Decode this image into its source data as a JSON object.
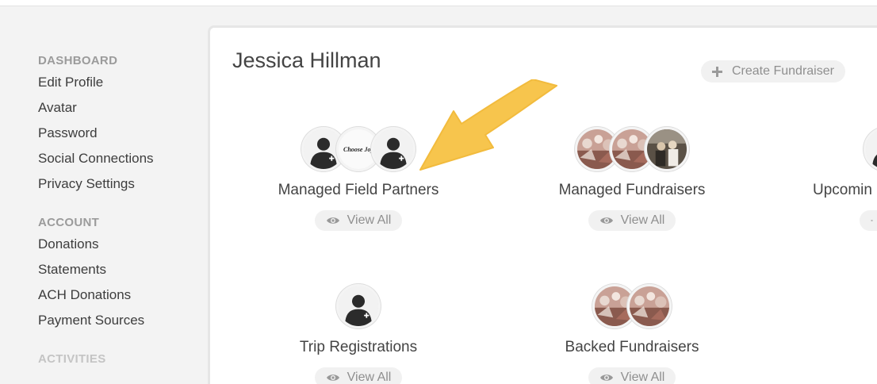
{
  "sidebar": {
    "groups": [
      {
        "heading": "DASHBOARD",
        "items": [
          "Edit Profile",
          "Avatar",
          "Password",
          "Social Connections",
          "Privacy Settings"
        ]
      },
      {
        "heading": "ACCOUNT",
        "items": [
          "Donations",
          "Statements",
          "ACH Donations",
          "Payment Sources"
        ]
      },
      {
        "heading": "ACTIVITIES",
        "items": []
      }
    ]
  },
  "panel": {
    "title": "Jessica Hillman",
    "create_label": "Create Fundraiser"
  },
  "cards": [
    {
      "title": "Managed Field Partners",
      "view_label": "View All",
      "avatars": [
        "person-avatar",
        "choose-joy-logo-avatar",
        "person-avatar"
      ]
    },
    {
      "title": "Managed Fundraisers",
      "view_label": "View All",
      "avatars": [
        "crowd-photo-avatar",
        "crowd-photo-avatar",
        "group-photo-avatar"
      ]
    },
    {
      "title": "Upcomin",
      "view_label": "",
      "avatars": [
        "person-avatar"
      ]
    },
    {
      "title": "Trip Registrations",
      "view_label": "View All",
      "avatars": [
        "person-avatar"
      ]
    },
    {
      "title": "Backed Fundraisers",
      "view_label": "View All",
      "avatars": [
        "crowd-photo-avatar",
        "crowd-photo-avatar"
      ]
    }
  ],
  "logo_text": "Choose Joy",
  "colors": {
    "arrow": "#f7c244",
    "background": "#f3f3f3",
    "sidebar_heading": "#9b9b9b"
  }
}
